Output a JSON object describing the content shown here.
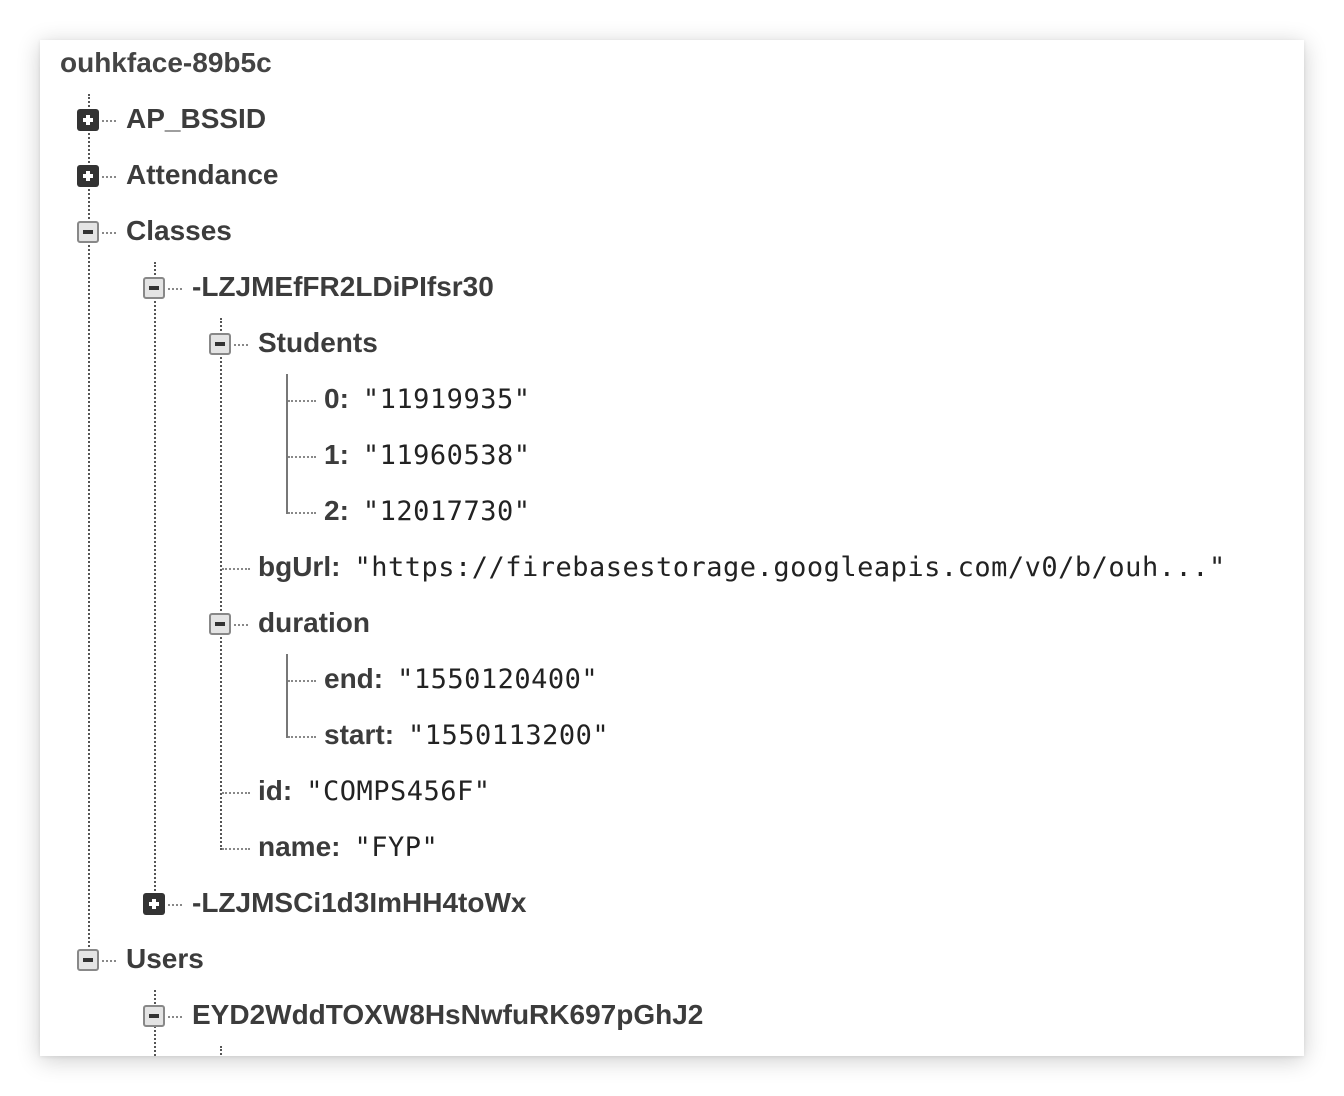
{
  "root_label": "ouhkface-89b5c",
  "nodes": {
    "ap_bssid": "AP_BSSID",
    "attendance": "Attendance",
    "classes": "Classes",
    "class1": "-LZJMEfFR2LDiPIfsr30",
    "students": "Students",
    "s0_key": "0",
    "s0_val": "\"11919935\"",
    "s1_key": "1",
    "s1_val": "\"11960538\"",
    "s2_key": "2",
    "s2_val": "\"12017730\"",
    "bgurl_key": "bgUrl",
    "bgurl_val": "\"https://firebasestorage.googleapis.com/v0/b/ouh...\"",
    "duration": "duration",
    "end_key": "end",
    "end_val": "\"1550120400\"",
    "start_key": "start",
    "start_val": "\"1550113200\"",
    "id_key": "id",
    "id_val": "\"COMPS456F\"",
    "name_key": "name",
    "name_val": "\"FYP\"",
    "class2": "-LZJMSCi1d3ImHH4toWx",
    "users": "Users",
    "user1": "EYD2WddTOXW8HsNwfuRK697pGhJ2"
  },
  "colon": ":"
}
